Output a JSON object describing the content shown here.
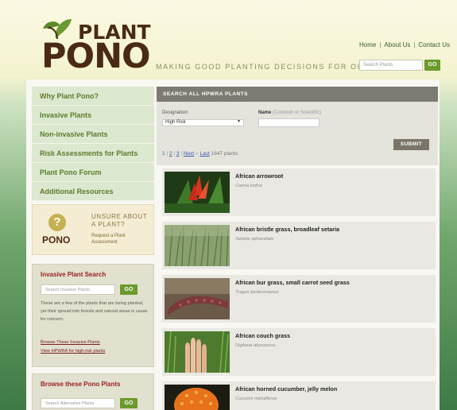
{
  "header": {
    "logo_top": "PLANT",
    "logo_bottom": "PONO",
    "tagline": "MAKING GOOD PLANTING DECISIONS FOR OUR ‘AINA",
    "nav": [
      "Home",
      "About Us",
      "Contact Us"
    ],
    "search_placeholder": "Search Plants",
    "go_label": "GO"
  },
  "sidebar": {
    "nav": [
      "Why Plant Pono?",
      "Invasive Plants",
      "Non-invasive Plants",
      "Risk Assessments for Plants",
      "Plant Pono Forum",
      "Additional Resources"
    ],
    "unsure": {
      "title": "UNSURE ABOUT A PLANT?",
      "brand": "PONO",
      "subtitle": "Request a Plant Assessment"
    },
    "invasive_search": {
      "title": "Invasive Plant Search",
      "placeholder": "Search Invasive Plants",
      "go_label": "GO",
      "text": "These are a few of the plants that are being planted, yet their spread into forests and natural areas is cause for concern.",
      "link1": "Browse These Invasive Plants",
      "link2": "View HPWRA for high-risk plants"
    },
    "browse": {
      "title": "Browse these Pono Plants",
      "placeholder": "Search Alternative Plants",
      "go_label": "GO"
    }
  },
  "main": {
    "heading": "SEARCH ALL HPWRA PLANTS",
    "designation_label": "Designation:",
    "designation_value": "High Risk",
    "name_label": "Name",
    "name_hint": "(Common or Scientific)",
    "submit_label": "SUBMIT",
    "pager": {
      "current": "1",
      "pages": [
        "2",
        "3"
      ],
      "next": "Next",
      "last": "Last",
      "count": "1647 plants"
    },
    "plants": [
      {
        "name": "African arrowroot",
        "sci": "Canna indica",
        "thumb": "canna"
      },
      {
        "name": "African bristle grass, broadleaf setaria",
        "sci": "Setaria sphacelata",
        "thumb": "grass"
      },
      {
        "name": "African bur grass, small carrot seed grass",
        "sci": "Tragus berteronianus",
        "thumb": "bur"
      },
      {
        "name": "African couch grass",
        "sci": "Digitaria abyssinica",
        "thumb": "hand"
      },
      {
        "name": "African horned cucumber, jelly melon",
        "sci": "Cucumis metuliferus",
        "thumb": "melon"
      }
    ]
  },
  "colors": {
    "nav_text": "#5a7d2d",
    "accent_green": "#6b9a2d",
    "brand_brown": "#4a2a14",
    "heading_red": "#9a2020"
  }
}
